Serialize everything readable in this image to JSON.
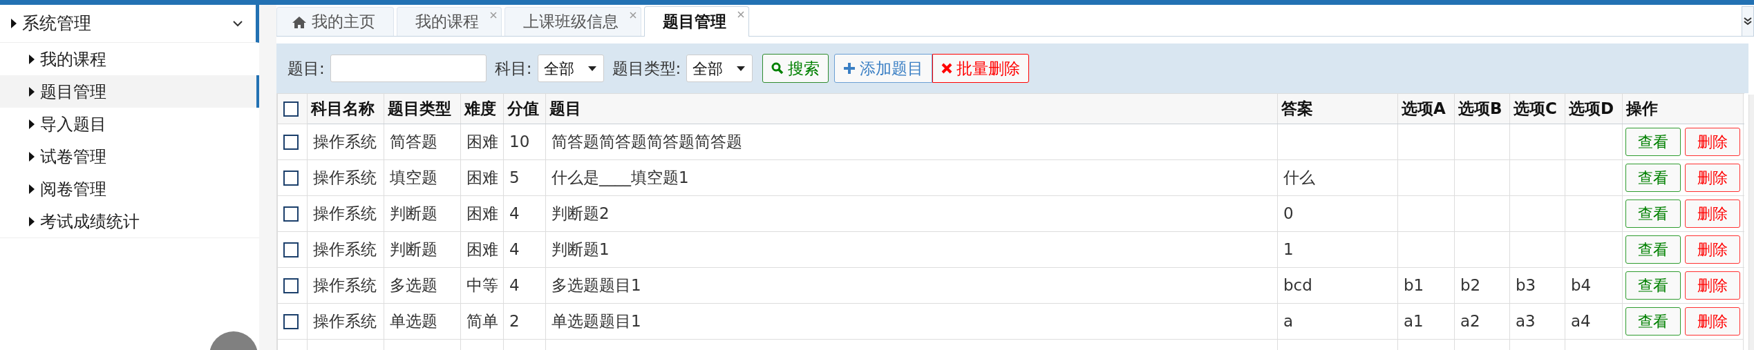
{
  "sidebar": {
    "group": {
      "label": "系统管理",
      "expanded": true
    },
    "items": [
      {
        "label": "我的课程",
        "selected": false
      },
      {
        "label": "题目管理",
        "selected": true
      },
      {
        "label": "导入题目",
        "selected": false
      },
      {
        "label": "试卷管理",
        "selected": false
      },
      {
        "label": "阅卷管理",
        "selected": false
      },
      {
        "label": "考试成绩统计",
        "selected": false
      }
    ]
  },
  "tabs": [
    {
      "label": "我的主页",
      "kind": "home",
      "closable": false,
      "selected": false
    },
    {
      "label": "我的课程",
      "kind": "page",
      "closable": true,
      "selected": false
    },
    {
      "label": "上课班级信息",
      "kind": "page",
      "closable": true,
      "selected": false
    },
    {
      "label": "题目管理",
      "kind": "page",
      "closable": true,
      "selected": true
    }
  ],
  "toolbar": {
    "fields": [
      {
        "kind": "input",
        "label": "题目:"
      },
      {
        "kind": "select",
        "label": "科目:",
        "value": "全部"
      },
      {
        "kind": "select",
        "label": "题目类型:",
        "value": "全部"
      }
    ],
    "buttons": [
      {
        "kind": "search",
        "label": "搜索"
      },
      {
        "kind": "add",
        "label": "添加题目"
      },
      {
        "kind": "delete",
        "label": "批量删除"
      }
    ]
  },
  "table": {
    "header_checked": false,
    "columns": [
      "科目名称",
      "题目类型",
      "难度",
      "分值",
      "题目",
      "答案",
      "选项A",
      "选项B",
      "选项C",
      "选项D",
      "操作"
    ],
    "rows": [
      {
        "checked": false,
        "cells": [
          "操作系统",
          "简答题",
          "困难",
          "10",
          "简答题简答题简答题简答题",
          "",
          "",
          "",
          "",
          ""
        ],
        "actions": [
          "查看",
          "删除"
        ]
      },
      {
        "checked": false,
        "cells": [
          "操作系统",
          "填空题",
          "困难",
          "5",
          "什么是____填空题1",
          "什么",
          "",
          "",
          "",
          ""
        ],
        "actions": [
          "查看",
          "删除"
        ]
      },
      {
        "checked": false,
        "cells": [
          "操作系统",
          "判断题",
          "困难",
          "4",
          "判断题2",
          "0",
          "",
          "",
          "",
          ""
        ],
        "actions": [
          "查看",
          "删除"
        ]
      },
      {
        "checked": false,
        "cells": [
          "操作系统",
          "判断题",
          "困难",
          "4",
          "判断题1",
          "1",
          "",
          "",
          "",
          ""
        ],
        "actions": [
          "查看",
          "删除"
        ]
      },
      {
        "checked": false,
        "cells": [
          "操作系统",
          "多选题",
          "中等",
          "4",
          "多选题题目1",
          "bcd",
          "b1",
          "b2",
          "b3",
          "b4"
        ],
        "actions": [
          "查看",
          "删除"
        ]
      },
      {
        "checked": false,
        "cells": [
          "操作系统",
          "单选题",
          "简单",
          "2",
          "单选题题目1",
          "a",
          "a1",
          "a2",
          "a3",
          "a4"
        ],
        "actions": [
          "查看",
          "删除"
        ]
      }
    ]
  }
}
